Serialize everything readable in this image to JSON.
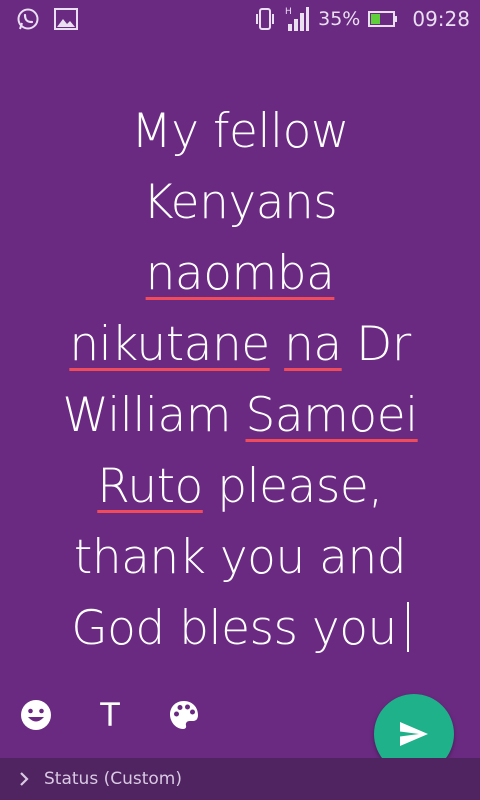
{
  "status_bar": {
    "icons_left": [
      "whatsapp-icon",
      "gallery-icon"
    ],
    "icons_right": [
      "vibrate-icon",
      "network-h-icon",
      "signal-icon",
      "battery-icon"
    ],
    "battery_percent": "35%",
    "time": "09:28"
  },
  "editor": {
    "line1": "My fellow",
    "line2": "Kenyans",
    "line3_word": "naomba",
    "line4_word1": "nikutane",
    "line4_word2": "na",
    "line4_rest": " Dr",
    "line5_start": "William ",
    "line5_word": "Samoei",
    "line6_word": "Ruto",
    "line6_rest": " please,",
    "line7": "thank you and",
    "line8": "God bless you",
    "background_color": "#6b2a82",
    "spellcheck_color": "#ef4b5a"
  },
  "toolbar": {
    "emoji_icon": "emoji-icon",
    "font_label": "T",
    "palette_icon": "palette-icon"
  },
  "send_button": {
    "icon": "send-icon",
    "color": "#1fb18a"
  },
  "bottom_bar": {
    "label": "Status (Custom)",
    "icon": "chevron-right-icon"
  }
}
